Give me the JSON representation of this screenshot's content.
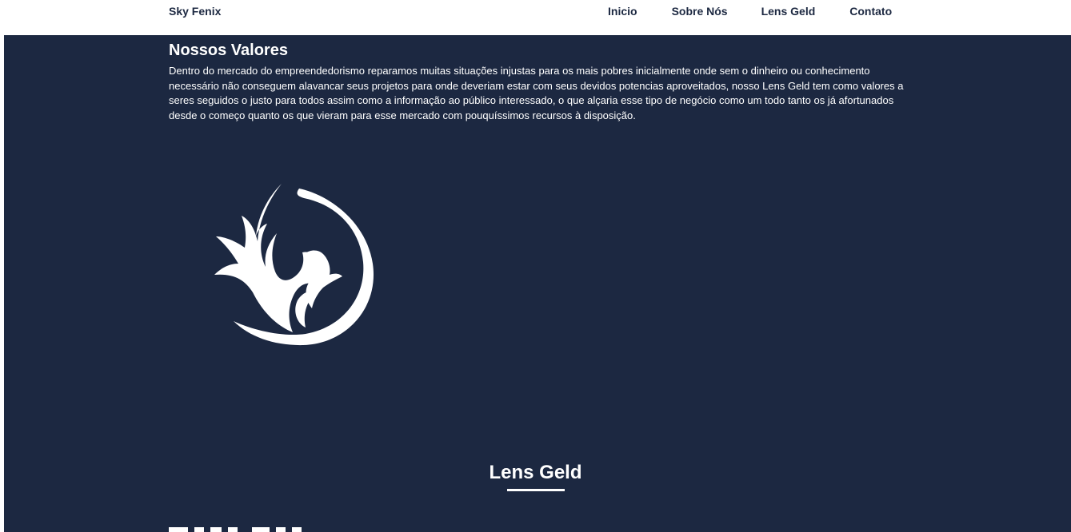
{
  "navbar": {
    "brand": "Sky Fenix",
    "links": [
      {
        "label": "Inicio"
      },
      {
        "label": "Sobre Nós"
      },
      {
        "label": "Lens Geld"
      },
      {
        "label": "Contato"
      }
    ]
  },
  "values": {
    "title": "Nossos Valores",
    "text": "Dentro do mercado do empreendedorismo reparamos muitas situações injustas para os mais pobres inicialmente onde sem o dinheiro ou conhecimento necessário não conseguem alavancar seus projetos para onde deveriam estar com seus devidos potencias aproveitados, nosso Lens Geld tem como valores a seres seguidos o justo para todos assim como a informação ao público interessado, o que alçaria esse tipo de negócio como um todo tanto os já afortunados desde o começo quanto os que vieram para esse mercado com pouquíssimos recursos à disposição."
  },
  "logo": {
    "icon": "phoenix-logo-icon",
    "color": "#ffffff"
  },
  "lens": {
    "title": "Lens Geld"
  },
  "theme": {
    "background": "#1c2841",
    "nav_background": "#ffffff",
    "text": "#ffffff"
  }
}
